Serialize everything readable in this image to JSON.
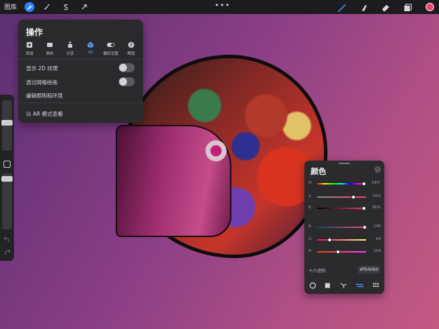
{
  "topbar": {
    "gallery_label": "图库",
    "more_label": "•••",
    "current_color": "#f6406d",
    "accent": "#2f82ff",
    "left_tools": [
      "wrench-icon",
      "magic-wand-icon",
      "selection-s-icon",
      "transform-arrow-icon"
    ],
    "right_tools": [
      "brush-icon",
      "smudge-icon",
      "eraser-icon",
      "layers-icon"
    ]
  },
  "actions": {
    "title": "操作",
    "tabs": [
      {
        "label": "添加",
        "icon": "add-icon"
      },
      {
        "label": "画布",
        "icon": "canvas-icon"
      },
      {
        "label": "分享",
        "icon": "share-icon"
      },
      {
        "label": "3D",
        "icon": "cube-icon",
        "active": true
      },
      {
        "label": "偏好设置",
        "icon": "toggle-icon"
      },
      {
        "label": "帮助",
        "icon": "help-icon"
      }
    ],
    "rows": [
      {
        "label": "显示 2D 纹理",
        "toggle": false
      },
      {
        "label": "透过网格绘画",
        "toggle": false
      },
      {
        "label": "编辑照明和环境"
      },
      {
        "label": "以 AR 模式查看"
      }
    ]
  },
  "color_panel": {
    "title": "颜色",
    "sliders": [
      {
        "key": "H",
        "value": "345°",
        "fraction": 0.96,
        "gradient": "linear-gradient(90deg,#f00,#ff0,#0f0,#0ff,#00f,#f0f,#f00)"
      },
      {
        "key": "S",
        "value": "74%",
        "fraction": 0.74,
        "gradient": "linear-gradient(90deg,#8a8a8a,#f6406d)"
      },
      {
        "key": "B",
        "value": "96%",
        "fraction": 0.96,
        "gradient": "linear-gradient(90deg,#000,#f6406d)"
      },
      {
        "key": "R",
        "value": "246",
        "fraction": 0.965,
        "gradient": "linear-gradient(90deg,#004c71,#ff4c71)"
      },
      {
        "key": "G",
        "value": "64",
        "fraction": 0.25,
        "gradient": "linear-gradient(90deg,#f6006d,#f6ff6d)"
      },
      {
        "key": "B",
        "value": "109",
        "fraction": 0.43,
        "gradient": "linear-gradient(90deg,#f64000,#f640ff)"
      }
    ],
    "hex_label": "十六进制",
    "hex_value": "f6406d",
    "modes": [
      "disc-icon",
      "classic-square-icon",
      "harmony-icon",
      "value-sliders-icon",
      "palettes-icon"
    ],
    "active_mode": "value-sliders-icon"
  }
}
